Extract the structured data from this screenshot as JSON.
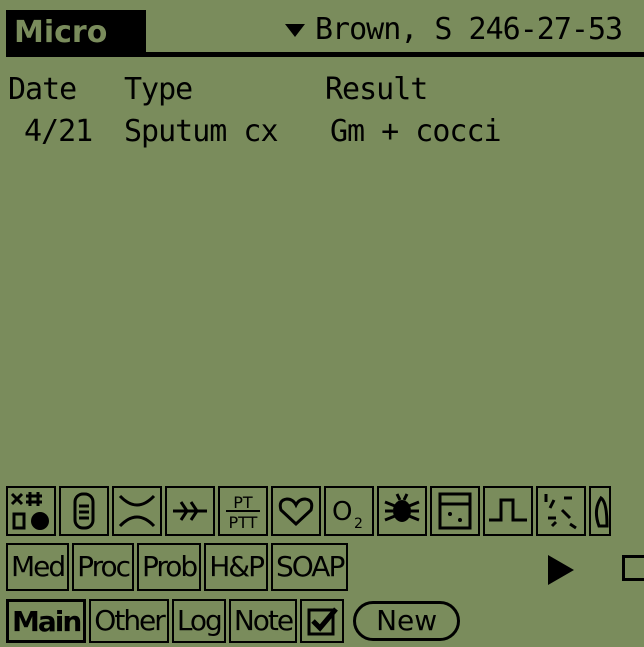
{
  "header": {
    "title": "Micro",
    "patient": "Brown, S 246-27-53"
  },
  "table": {
    "columns": [
      "Date",
      "Type",
      "Result"
    ],
    "rows": [
      {
        "date": "4/21",
        "type": "Sputum cx",
        "result": "Gm + cocci"
      }
    ]
  },
  "icons": [
    {
      "name": "orders-icon"
    },
    {
      "name": "tube-icon"
    },
    {
      "name": "xray-icon"
    },
    {
      "name": "ekg-icon"
    },
    {
      "name": "pt-ptt-icon",
      "label_top": "PT",
      "label_bottom": "PTT"
    },
    {
      "name": "heart-icon"
    },
    {
      "name": "o2-icon",
      "label": "O"
    },
    {
      "name": "bug-icon"
    },
    {
      "name": "urine-cup-icon"
    },
    {
      "name": "pulse-icon"
    },
    {
      "name": "sparkle-icon"
    },
    {
      "name": "lungs-icon"
    }
  ],
  "categories": [
    "Med",
    "Proc",
    "Prob",
    "H&P",
    "SOAP"
  ],
  "tabs": [
    {
      "label": "Main",
      "active": true
    },
    {
      "label": "Other"
    },
    {
      "label": "Log"
    },
    {
      "label": "Note"
    }
  ],
  "new_button": "New",
  "colors": {
    "background": "#7a8c5c",
    "foreground": "#000000"
  }
}
